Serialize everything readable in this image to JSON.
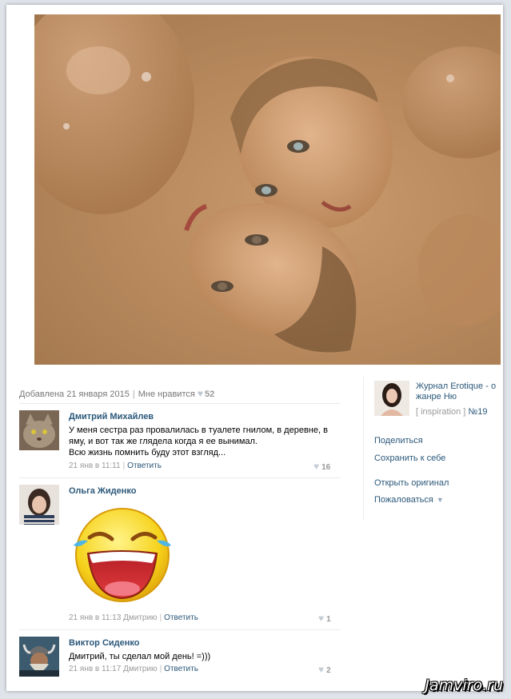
{
  "photo": {
    "icon": "photo-image"
  },
  "post": {
    "added": "Добавлена 21 января 2015",
    "like_label": "Мне нравится",
    "like_count": "52"
  },
  "comments": [
    {
      "author": "Дмитрий Михайлев",
      "lines": [
        "У меня сестра раз провалилась в туалете гнилом, в деревне, в",
        "яму, и вот так же глядела когда я ее вынимал.",
        "Всю жизнь помнить буду этот взгляд..."
      ],
      "date": "21 янв в 11:11",
      "reply": "Ответить",
      "likes": "16"
    },
    {
      "author": "Ольга Жиденко",
      "emoji": "laughing-crying-smiley",
      "date": "21 янв в 11:13",
      "to": "Дмитрию",
      "reply": "Ответить",
      "likes": "1"
    },
    {
      "author": "Виктор Сиденко",
      "text": "Дмитрий, ты сделал мой день! =)))",
      "date": "21 янв в 11:17",
      "to": "Дмитрию",
      "reply": "Ответить",
      "likes": "2"
    }
  ],
  "album": {
    "title": "Журнал Erotique - о жанре Ню",
    "tag_open": "[ inspiration ]",
    "tag_num": "№19"
  },
  "actions": {
    "share": "Поделиться",
    "save": "Сохранить к себе",
    "open": "Открыть оригинал",
    "report": "Пожаловаться"
  },
  "watermark": "Jamviro.ru"
}
